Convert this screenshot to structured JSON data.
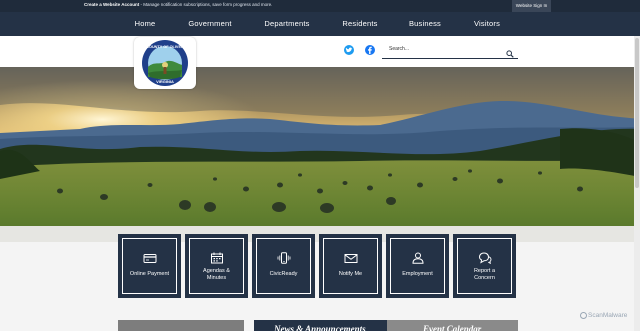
{
  "topbar": {
    "create_account_bold": "Create a Website Account",
    "create_account_text": " - Manage notification subscriptions, save form progress and more.",
    "signin_label": "Website Sign In"
  },
  "nav": {
    "items": [
      {
        "label": "Home"
      },
      {
        "label": "Government"
      },
      {
        "label": "Departments"
      },
      {
        "label": "Residents"
      },
      {
        "label": "Business"
      },
      {
        "label": "Visitors"
      }
    ]
  },
  "header": {
    "twitter_icon": "twitter-icon",
    "facebook_icon": "facebook-icon",
    "search_placeholder": "Search...",
    "logo_top_text": "COUNTY OF OLIVER",
    "logo_bottom_text": "VIRGINIA"
  },
  "quick_links": [
    {
      "label_line1": "Online Payment",
      "label_line2": "",
      "icon": "credit-card-icon"
    },
    {
      "label_line1": "Agendas &",
      "label_line2": "Minutes",
      "icon": "calendar-icon"
    },
    {
      "label_line1": "CivicReady",
      "label_line2": "",
      "icon": "phone-vibrate-icon"
    },
    {
      "label_line1": "Notify Me",
      "label_line2": "",
      "icon": "envelope-icon"
    },
    {
      "label_line1": "Employment",
      "label_line2": "",
      "icon": "person-icon"
    },
    {
      "label_line1": "Report a",
      "label_line2": "Concern",
      "icon": "chat-bubbles-icon"
    }
  ],
  "sections": {
    "news_title": "News & Announcements",
    "events_title": "Event Calendar"
  },
  "watermark": "ScanMalware",
  "colors": {
    "navy": "#243246",
    "topbar": "#1f2b3b",
    "twitter": "#1d9bf0",
    "facebook": "#1877f2"
  }
}
